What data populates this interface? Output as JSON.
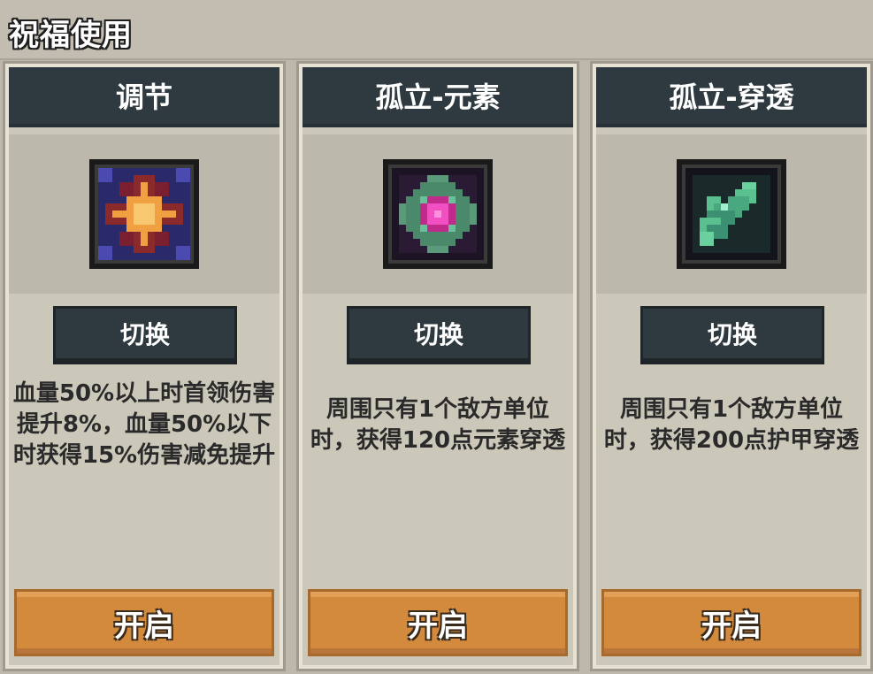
{
  "page": {
    "title": "祝福使用"
  },
  "cards": [
    {
      "name": "调节",
      "icon": "radiant-star-icon",
      "switch_label": "切换",
      "description": "血量50%以上时首领伤害提升8%，血量50%以下时获得15%伤害减免提升",
      "open_label": "开启"
    },
    {
      "name": "孤立-元素",
      "icon": "element-orb-icon",
      "switch_label": "切换",
      "description": "周围只有1个敌方单位时，获得120点元素穿透",
      "open_label": "开启"
    },
    {
      "name": "孤立-穿透",
      "icon": "armor-pierce-icon",
      "switch_label": "切换",
      "description": "周围只有1个敌方单位时，获得200点护甲穿透",
      "open_label": "开启"
    }
  ],
  "colors": {
    "header_bg": "#2f3a40",
    "open_button": "#d38a3d",
    "card_bg": "#cbc7b9"
  }
}
